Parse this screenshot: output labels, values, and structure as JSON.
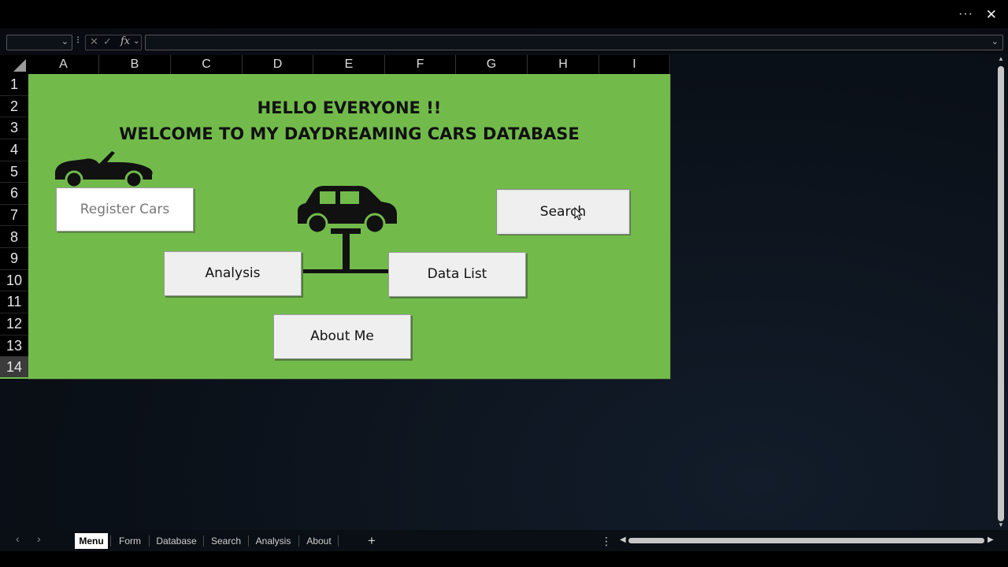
{
  "window": {
    "more_label": "···",
    "close_label": "✕"
  },
  "formula_bar": {
    "name_box_value": "",
    "cancel_label": "✕",
    "enter_label": "✓",
    "fx_label": "fx",
    "formula_value": ""
  },
  "columns": [
    "A",
    "B",
    "C",
    "D",
    "E",
    "F",
    "G",
    "H",
    "I"
  ],
  "rows": [
    "1",
    "2",
    "3",
    "4",
    "5",
    "6",
    "7",
    "8",
    "9",
    "10",
    "11",
    "12",
    "13",
    "14"
  ],
  "selected_row": "14",
  "sheet": {
    "background_color": "#72bb4b",
    "title_line1": "HELLO EVERYONE !!",
    "title_line2": "WELCOME TO MY DAYDREAMING CARS DATABASE",
    "buttons": {
      "register": "Register Cars",
      "search": "Search",
      "analysis": "Analysis",
      "data_list": "Data List",
      "about_me": "About Me"
    },
    "icons": [
      "convertible-car-icon",
      "car-lift-icon"
    ]
  },
  "tabs": [
    "Menu",
    "Form",
    "Database",
    "Search",
    "Analysis",
    "About"
  ],
  "active_tab": "Menu",
  "tabbar": {
    "add_label": "+",
    "options_label": "⋮"
  }
}
